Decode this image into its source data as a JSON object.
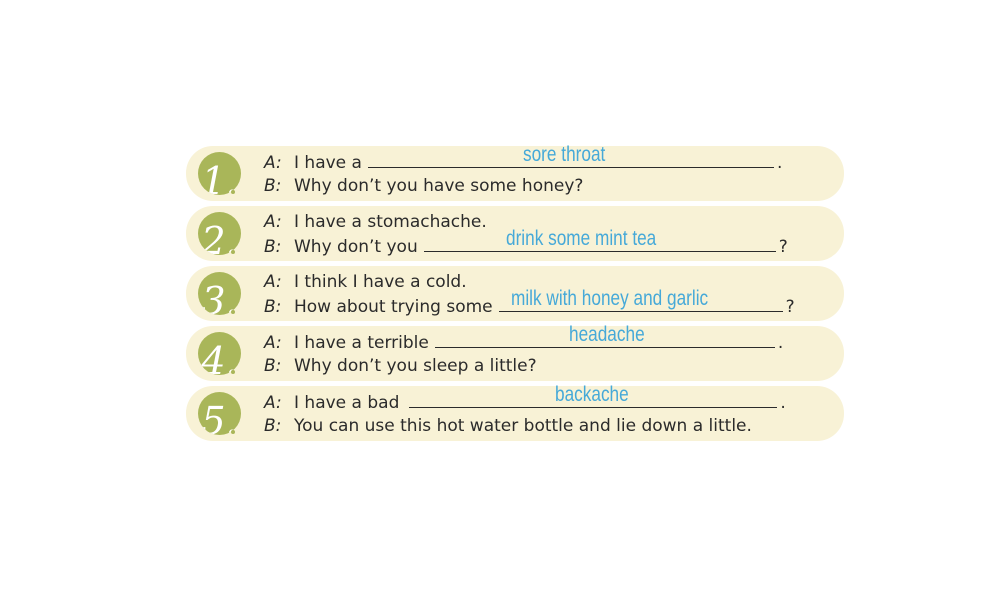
{
  "exercise": {
    "items": [
      {
        "number": "1.",
        "speaker_a": "A:",
        "speaker_b": "B:",
        "line_a_before": "I have a",
        "line_a_after": ".",
        "line_a_answer": "sore throat",
        "line_b_before": "Why don’t you have some honey?",
        "line_b_after": "",
        "line_b_answer": ""
      },
      {
        "number": "2.",
        "speaker_a": "A:",
        "speaker_b": "B:",
        "line_a_before": "I have a stomachache.",
        "line_a_after": "",
        "line_a_answer": "",
        "line_b_before": "Why don’t you",
        "line_b_after": "?",
        "line_b_answer": "drink some mint tea"
      },
      {
        "number": "3.",
        "speaker_a": "A:",
        "speaker_b": "B:",
        "line_a_before": "I think I have a cold.",
        "line_a_after": "",
        "line_a_answer": "",
        "line_b_before": "How about trying some",
        "line_b_after": "?",
        "line_b_answer": "milk with honey and garlic"
      },
      {
        "number": "4.",
        "speaker_a": "A:",
        "speaker_b": "B:",
        "line_a_before": "I have a terrible",
        "line_a_after": ".",
        "line_a_answer": "headache",
        "line_b_before": "Why don’t you sleep a little?",
        "line_b_after": "",
        "line_b_answer": ""
      },
      {
        "number": "5.",
        "speaker_a": "A:",
        "speaker_b": "B:",
        "line_a_before": "I have a bad",
        "line_a_after": ".",
        "line_a_answer": "backache",
        "line_b_before": "You can use this hot water bottle and lie down a little.",
        "line_b_after": "",
        "line_b_answer": ""
      }
    ]
  },
  "colors": {
    "row_background": "#f8f2d6",
    "badge": "#a9b659",
    "answer_text": "#46a9d8",
    "body_text": "#2b2b2b"
  }
}
